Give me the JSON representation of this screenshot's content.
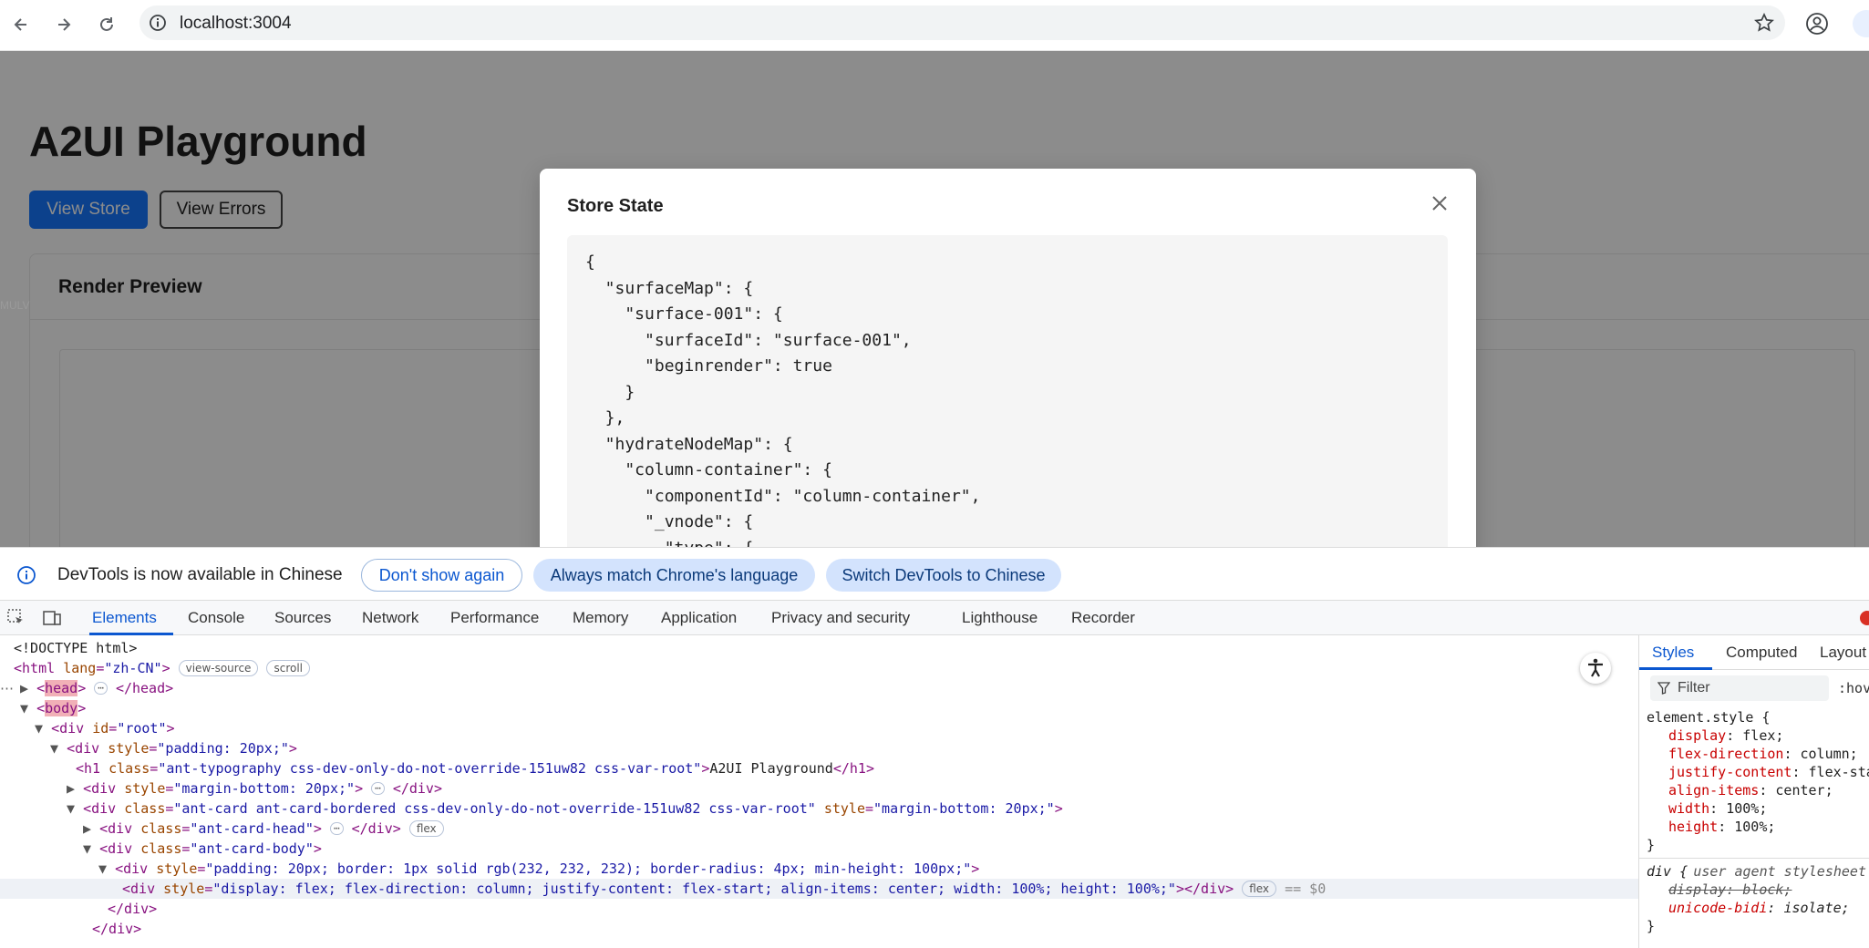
{
  "browser": {
    "url": "localhost:3004",
    "icons": {
      "back": "back-arrow-icon",
      "forward": "forward-arrow-icon",
      "reload": "reload-icon",
      "info": "info-icon",
      "bookmark": "star-icon",
      "profile": "profile-icon"
    }
  },
  "page": {
    "title": "A2UI Playground",
    "view_store_label": "View Store",
    "view_errors_label": "View Errors",
    "card_title": "Render Preview",
    "side_label": "MULV",
    "primary_color": "#1677ff"
  },
  "modal": {
    "title": "Store State",
    "close_icon": "close-icon",
    "code_lines": [
      "{",
      "  \"surfaceMap\": {",
      "    \"surface-001\": {",
      "      \"surfaceId\": \"surface-001\",",
      "      \"beginrender\": true",
      "    }",
      "  },",
      "  \"hydrateNodeMap\": {",
      "    \"column-container\": {",
      "      \"componentId\": \"column-container\",",
      "      \"_vnode\": {",
      "        \"type\": {"
    ]
  },
  "notice": {
    "text": "DevTools is now available in Chinese",
    "dont_show": "Don't show again",
    "always_match": "Always match Chrome's language",
    "switch": "Switch DevTools to Chinese"
  },
  "devtools": {
    "tabs": [
      "Elements",
      "Console",
      "Sources",
      "Network",
      "Performance",
      "Memory",
      "Application",
      "Privacy and security",
      "Lighthouse",
      "Recorder"
    ],
    "active_tab": "Elements",
    "dom": {
      "doctype": "<!DOCTYPE html>",
      "html_open": "<html",
      "html_lang_attr": "lang",
      "html_lang_val": "\"zh-CN\"",
      "badge_view_source": "view-source",
      "badge_scroll": "scroll",
      "badge_flex": "flex",
      "head_tag": "head",
      "head_close": "</head>",
      "body_tag": "body",
      "root_open": "<div",
      "root_attr": "id",
      "root_val": "\"root\"",
      "style_attr": "style",
      "class_attr": "class",
      "div_padding_val": "\"padding: 20px;\"",
      "h1_class_val": "\"ant-typography css-dev-only-do-not-override-151uw82 css-var-root\"",
      "h1_text": "A2UI Playground",
      "div_mb_val": "\"margin-bottom: 20px;\"",
      "card_class_val": "\"ant-card ant-card-bordered css-dev-only-do-not-override-151uw82 css-var-root\"",
      "card_head_val": "\"ant-card-head\"",
      "card_body_val": "\"ant-card-body\"",
      "inner_style_val": "\"padding: 20px; border: 1px solid rgb(232, 232, 232); border-radius: 4px; min-height: 100px;\"",
      "selected_style_val": "\"display: flex; flex-direction: column; justify-content: flex-start; align-items: center; width: 100%; height: 100%;\"",
      "selected_marker": "== $0",
      "div_close": "</div>"
    },
    "styles": {
      "tabs": [
        "Styles",
        "Computed",
        "Layout"
      ],
      "filter_placeholder": "Filter",
      "hov": ":hov",
      "element_style_selector": "element.style {",
      "props": [
        {
          "name": "display",
          "value": "flex;"
        },
        {
          "name": "flex-direction",
          "value": "column;"
        },
        {
          "name": "justify-content",
          "value": "flex-start;"
        },
        {
          "name": "align-items",
          "value": "center;"
        },
        {
          "name": "width",
          "value": "100%;"
        },
        {
          "name": "height",
          "value": "100%;"
        }
      ],
      "close_brace": "}",
      "div_selector": "div {",
      "div_origin": "user agent stylesheet",
      "ua_props": [
        {
          "name": "display",
          "value": "block;"
        },
        {
          "name": "unicode-bidi",
          "value": "isolate;"
        }
      ]
    }
  }
}
